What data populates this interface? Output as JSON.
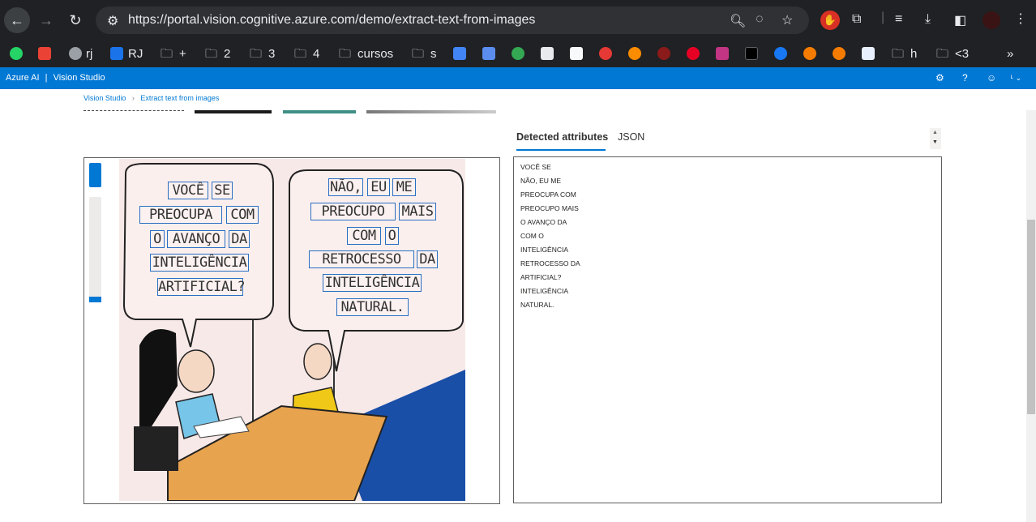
{
  "browser": {
    "url": "https://portal.vision.cognitive.azure.com/demo/extract-text-from-images",
    "bookmarks": [
      "rj",
      "RJ",
      "+",
      "2",
      "3",
      "4",
      "cursos",
      "s",
      "h",
      "<3"
    ]
  },
  "app": {
    "brand": "Azure AI",
    "product": "Vision Studio",
    "separator": "|"
  },
  "breadcrumb": {
    "root": "Vision Studio",
    "sep": "›",
    "current": "Extract text from images"
  },
  "tabs": [
    "Detected attributes",
    "JSON"
  ],
  "comic_words": [
    "VOCÊ",
    "SE",
    "PREOCUPA",
    "COM",
    "O",
    "AVANÇO",
    "DA",
    "INTELIGÊNCIA",
    "ARTIFICIAL?",
    "NÃO,",
    "EU",
    "ME",
    "PREOCUPO",
    "MAIS",
    "COM",
    "O",
    "RETROCESSO",
    "DA",
    "INTELIGÊNCIA",
    "NATURAL."
  ],
  "detected_lines": [
    "VOCÊ SE",
    "NÃO, EU ME",
    "PREOCUPA COM",
    "PREOCUPO MAIS",
    "O AVANÇO DA",
    "COM O",
    "INTELIGÊNCIA",
    "RETROCESSO DA",
    "ARTIFICIAL?",
    "INTELIGÊNCIA",
    "NATURAL."
  ],
  "colors": {
    "accent": "#0078d4",
    "chrome": "#202124",
    "ocr_box": "#2a6fc2"
  }
}
